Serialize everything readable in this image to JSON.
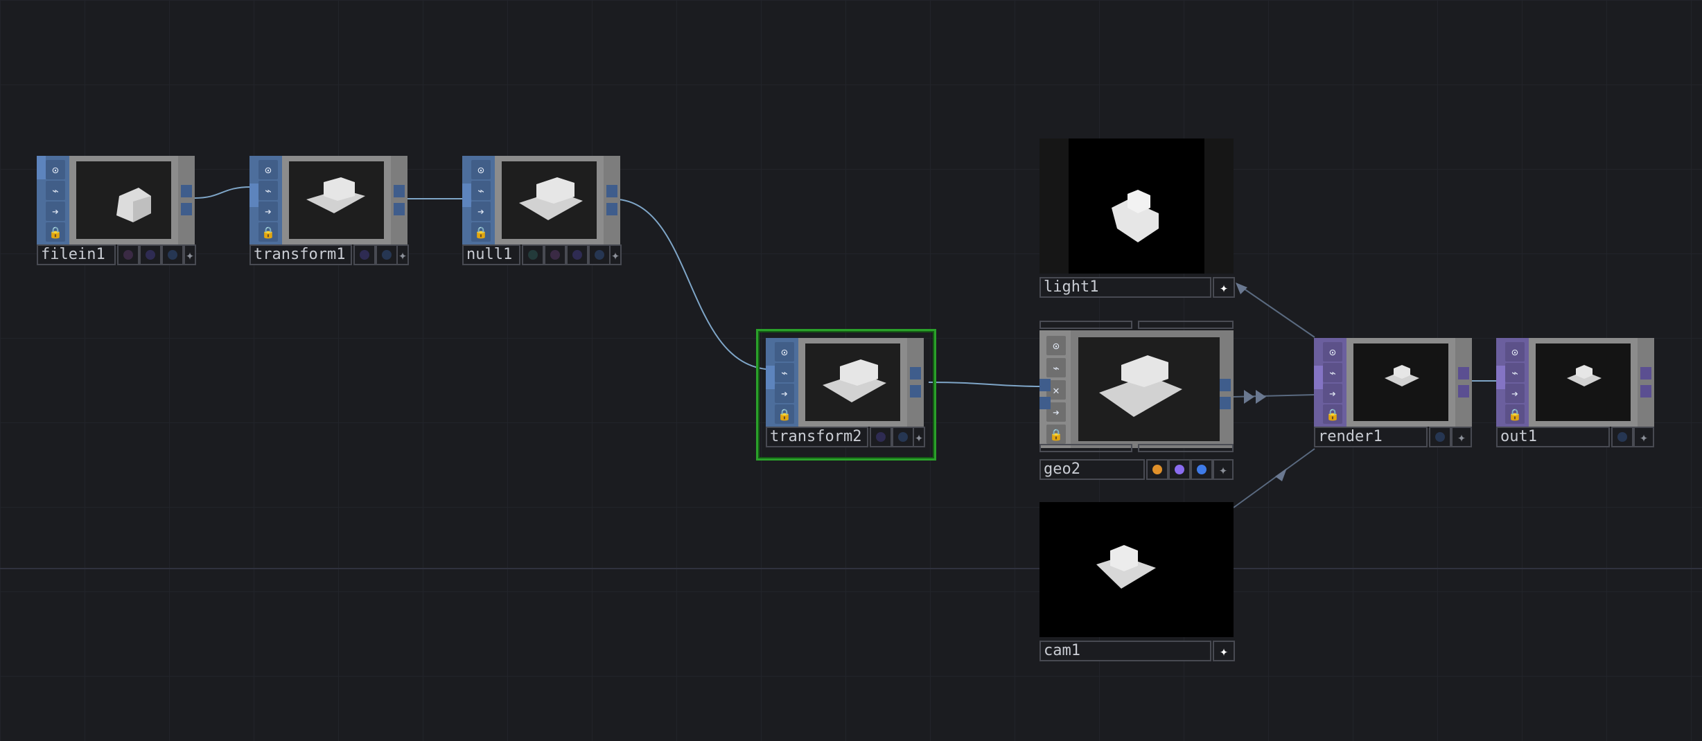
{
  "nodes": {
    "filein1": {
      "label": "filein1"
    },
    "transform1": {
      "label": "transform1"
    },
    "null1": {
      "label": "null1"
    },
    "transform2": {
      "label": "transform2"
    },
    "light1": {
      "label": "light1"
    },
    "geo2": {
      "label": "geo2"
    },
    "cam1": {
      "label": "cam1"
    },
    "render1": {
      "label": "render1"
    },
    "out1": {
      "label": "out1"
    }
  },
  "icons": {
    "viewer": "⊙",
    "bypass": "⌁",
    "cook": "➔",
    "lock": "🔒",
    "clear": "✕",
    "plus": "✦"
  },
  "colors": {
    "background": "#1b1c20",
    "sop_strip": "#4d6e9c",
    "top_strip": "#6b5f9e",
    "selection": "#2aa12a",
    "wire": "#7fa6c8",
    "geo_flag_orange": "#e0902a",
    "geo_flag_purple": "#8a6cf0",
    "geo_flag_blue": "#3f7be8"
  }
}
